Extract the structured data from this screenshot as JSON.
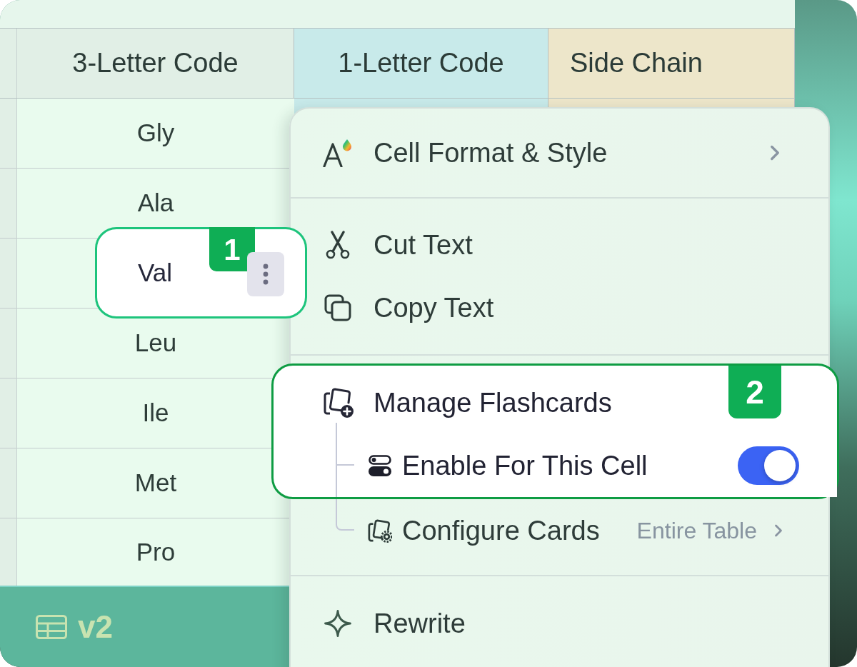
{
  "table": {
    "columns": [
      {
        "label": "3-Letter Code",
        "color": "#e1efe6"
      },
      {
        "label": "1-Letter Code",
        "color": "#c8eaea"
      },
      {
        "label": "Side Chain",
        "color": "#ede6ca"
      }
    ],
    "rows": [
      {
        "three_letter_code": "Gly",
        "selected": false
      },
      {
        "three_letter_code": "Ala",
        "selected": false
      },
      {
        "three_letter_code": "Val",
        "selected": true,
        "callout": "1"
      },
      {
        "three_letter_code": "Leu",
        "selected": false
      },
      {
        "three_letter_code": "Ile",
        "selected": false
      },
      {
        "three_letter_code": "Met",
        "selected": false
      },
      {
        "three_letter_code": "Pro",
        "selected": false
      }
    ]
  },
  "footer": {
    "label": "v2"
  },
  "context_menu": {
    "sections": [
      {
        "items": [
          {
            "kind": "submenu",
            "label": "Cell Format & Style"
          }
        ]
      },
      {
        "items": [
          {
            "kind": "action",
            "label": "Cut Text"
          },
          {
            "kind": "action",
            "label": "Copy Text"
          }
        ]
      },
      {
        "items": [
          {
            "kind": "group",
            "label": "Manage Flashcards",
            "highlighted": true,
            "callout": "2",
            "children": [
              {
                "kind": "toggle",
                "label": "Enable For This Cell",
                "highlighted": true,
                "on": true
              },
              {
                "kind": "submenu",
                "label": "Configure Cards",
                "value": "Entire Table",
                "highlighted": false
              }
            ]
          }
        ]
      },
      {
        "items": [
          {
            "kind": "action",
            "label": "Rewrite"
          }
        ]
      }
    ]
  }
}
